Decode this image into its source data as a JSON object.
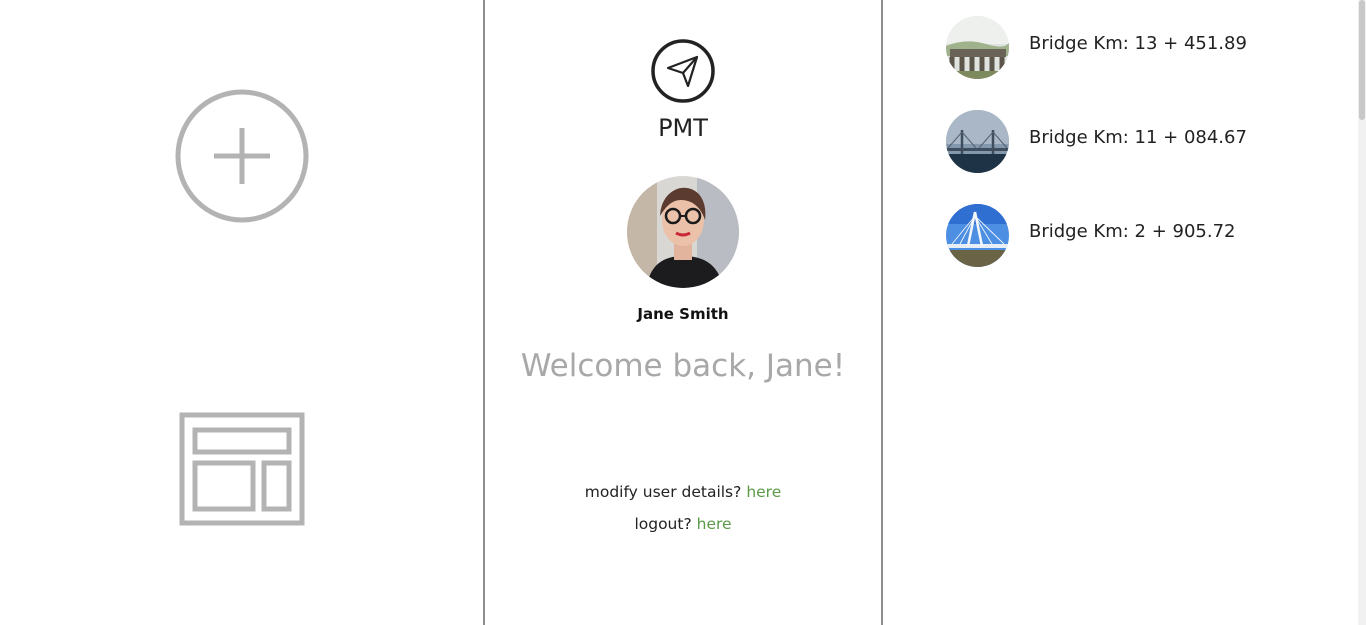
{
  "left_panel": {
    "add_icon": "plus-circle-icon",
    "layout_icon": "layout-icon",
    "icon_color": "#b3b3b3"
  },
  "brand": {
    "name": "PMT",
    "logo_icon": "paper-plane-icon"
  },
  "user": {
    "name": "Jane Smith",
    "welcome": "Welcome back, Jane!"
  },
  "links": {
    "modify_prefix": "modify user details?",
    "modify_link": "here",
    "logout_prefix": "logout?",
    "logout_link": "here",
    "link_color": "#5a9a48"
  },
  "bridges": [
    {
      "label": "Bridge Km: 13 + 451.89"
    },
    {
      "label": "Bridge Km: 11 + 084.67"
    },
    {
      "label": "Bridge Km: 2 + 905.72"
    }
  ]
}
